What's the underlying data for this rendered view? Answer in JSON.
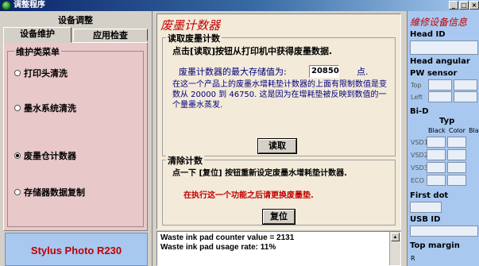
{
  "window": {
    "title": "调整程序",
    "min": "_",
    "max": "□",
    "close": "×"
  },
  "left": {
    "header": "设备调整",
    "tabs": [
      "设备维护",
      "应用检查"
    ],
    "group_title": "维护类菜单",
    "options": [
      {
        "label": "打印头清洗",
        "selected": false
      },
      {
        "label": "墨水系统清洗",
        "selected": false
      },
      {
        "label": "废墨仓计数器",
        "selected": true
      },
      {
        "label": "存储器数据复制",
        "selected": false
      }
    ],
    "model": "Stylus Photo R230"
  },
  "center": {
    "title": "废墨计数器",
    "read": {
      "group_title": "读取废墨计数",
      "instruction": "点击[读取]按钮从打印机中获得废墨数据.",
      "max_label": "废墨计数器的最大存储值为:",
      "max_value": "20850",
      "max_unit": "点.",
      "note": "在这一个产品上的废墨水增耗垫计数器的上面有限制数值是变数从 20000 到 46750. 这是因为在增耗垫被反映到数值的一个量墨水蒸发.",
      "button": "读取"
    },
    "clear": {
      "group_title": "清除计数",
      "instruction": "点一下 [复位] 按钮重新设定废墨水增耗垫计数器.",
      "warning": "在执行这一个功能之后请更换废墨垫.",
      "button": "复位"
    },
    "log": [
      "Waste ink pad counter value = 2131",
      "Waste ink pad usage rate: 11%"
    ]
  },
  "right": {
    "title": "維修设备信息",
    "head_id": "Head ID",
    "head_angular": "Head angular",
    "pw_sensor": "PW sensor",
    "top": "Top",
    "left": "Left",
    "bi_d": "Bi-D",
    "typ": "Typ",
    "colors": [
      "Black",
      "Color",
      "Bla"
    ],
    "vsd_rows": [
      "VSD1",
      "VSD2",
      "VSD3",
      "ECO"
    ],
    "first_dot": "First dot",
    "usb_id": "USB ID",
    "top_margin": "Top margin",
    "r": "R"
  }
}
